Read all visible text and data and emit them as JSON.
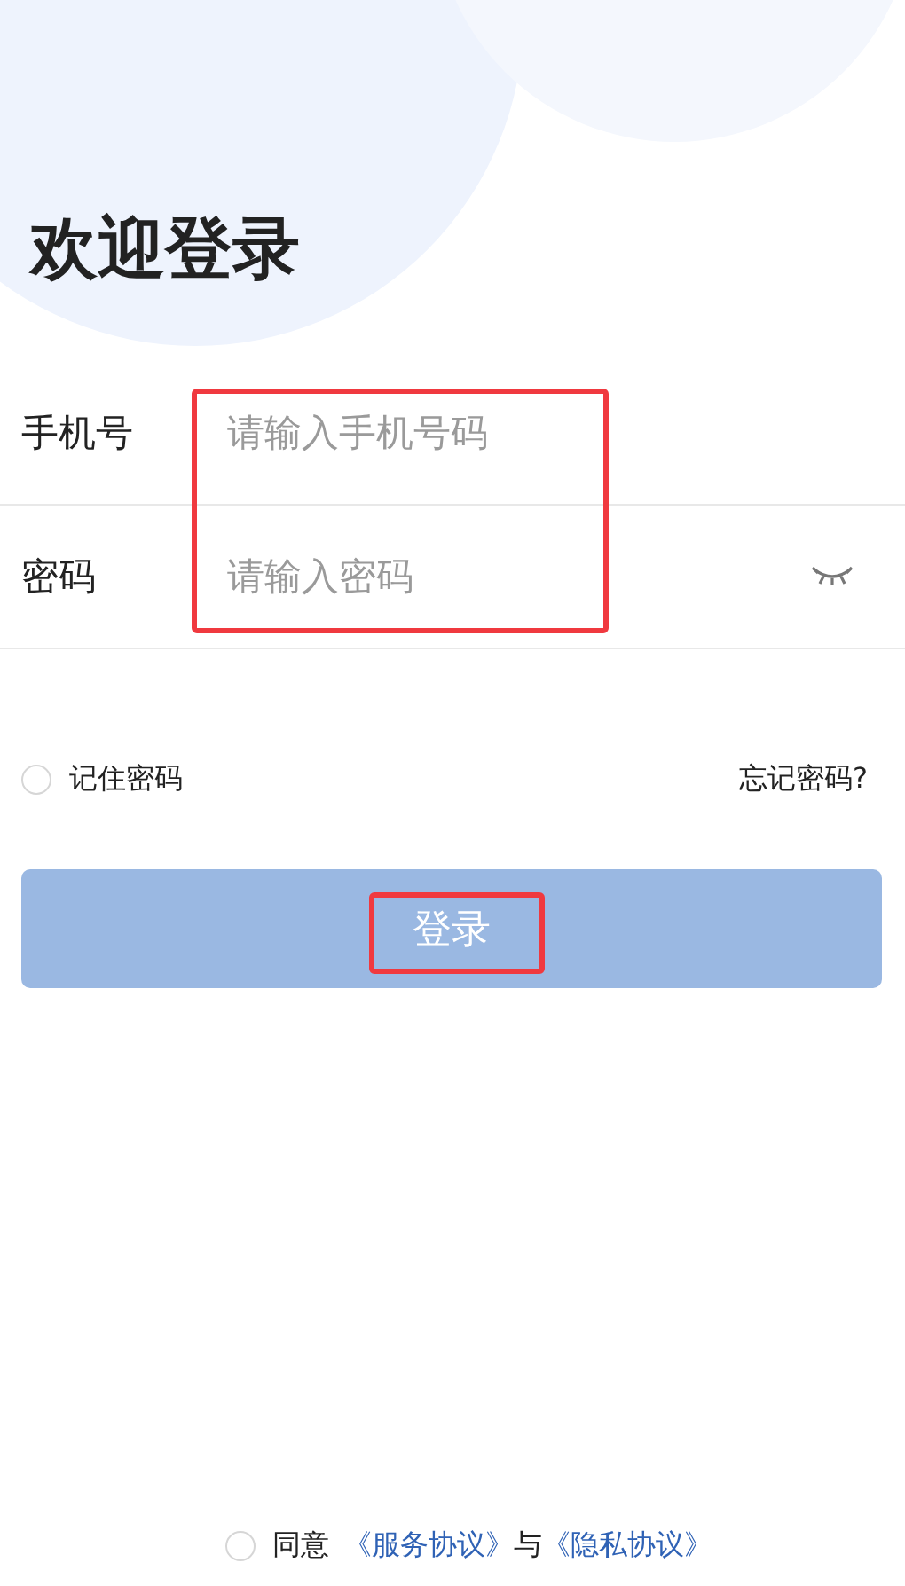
{
  "title": "欢迎登录",
  "fields": [
    {
      "kind": "text",
      "label": "手机号",
      "placeholder": "请输入手机号码"
    },
    {
      "kind": "password",
      "label": "密码",
      "placeholder": "请输入密码"
    }
  ],
  "fields_highlighted": true,
  "remember": {
    "label": "记住密码",
    "checked": false
  },
  "forgot_link": "忘记密码?",
  "login_button": {
    "label": "登录",
    "highlighted": true
  },
  "agreement": {
    "checked": false,
    "prefix": "同意",
    "links": [
      "《服务协议》",
      "《隐私协议》"
    ],
    "joiner": "与"
  }
}
